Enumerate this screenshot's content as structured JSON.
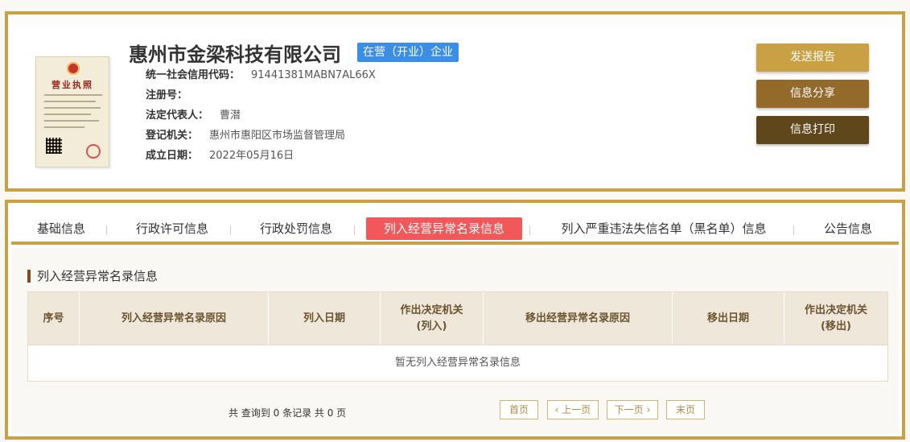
{
  "company": {
    "name": "惠州市金梁科技有限公司",
    "status": "在营（开业）企业",
    "license_title": "营业执照",
    "fields": [
      {
        "key": "统一社会信用代码：",
        "value": "91441381MABN7AL66X"
      },
      {
        "key": "注册号：",
        "value": ""
      },
      {
        "key": "法定代表人：",
        "value": "曹潜"
      },
      {
        "key": "登记机关：",
        "value": "惠州市惠阳区市场监督管理局"
      },
      {
        "key": "成立日期：",
        "value": "2022年05月16日"
      }
    ]
  },
  "actions": {
    "send": "发送报告",
    "share": "信息分享",
    "print": "信息打印"
  },
  "tabs": [
    {
      "label": "基础信息",
      "active": false
    },
    {
      "label": "行政许可信息",
      "active": false
    },
    {
      "label": "行政处罚信息",
      "active": false
    },
    {
      "label": "列入经营异常名录信息",
      "active": true
    },
    {
      "label": "列入严重违法失信名单（黑名单）信息",
      "active": false
    },
    {
      "label": "公告信息",
      "active": false
    }
  ],
  "section": {
    "title": "列入经营异常名录信息",
    "columns": [
      "序号",
      "列入经营异常名录原因",
      "列入日期",
      "作出决定机关\n(列入)",
      "移出经营异常名录原因",
      "移出日期",
      "作出决定机关\n(移出)"
    ],
    "empty_text": "暂无列入经营异常名录信息"
  },
  "pagination": {
    "summary": "共 查询到 0 条记录 共 0 页",
    "first": "首页",
    "prev": "上一页",
    "next": "下一页",
    "last": "末页"
  },
  "colors": {
    "border_gold": "#c9a043",
    "badge_blue": "#3a8ee6",
    "tab_active": "#f2575a",
    "btn_send": "#c9a043",
    "btn_share": "#946a2b",
    "btn_print": "#5f461b"
  }
}
